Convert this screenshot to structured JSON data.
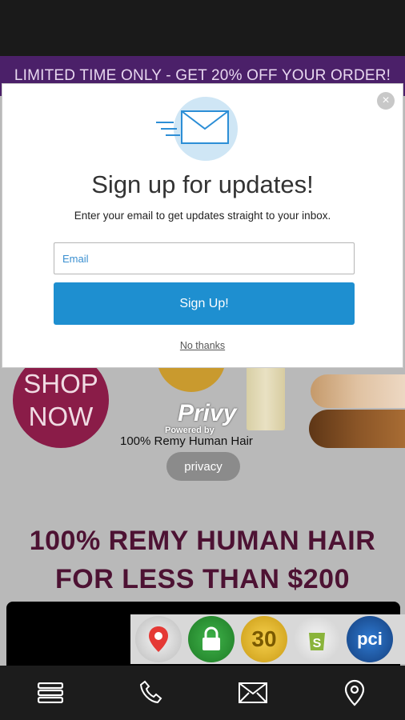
{
  "promo_banner": {
    "text": "LIMITED TIME ONLY - GET 20% OFF YOUR ORDER!"
  },
  "modal": {
    "title": "Sign up for updates!",
    "subtitle": "Enter your email to get updates straight to your inbox.",
    "email_placeholder": "Email",
    "signup_label": "Sign Up!",
    "no_thanks_label": "No thanks",
    "close_icon": "close-icon",
    "emblem_icon": "envelope-icon"
  },
  "background": {
    "shop_now_line1": "SHOP",
    "shop_now_line2": "NOW",
    "product_caption": "100% Remy Human Hair",
    "privy_logo": "Privy",
    "privy_powered": "Powered by",
    "privacy_label": "privacy",
    "headline_line1": "100% REMY HUMAN HAIR",
    "headline_line2": "FOR LESS THAN $200",
    "trust_badges": [
      {
        "icon": "map-pin-badge-icon",
        "label": ""
      },
      {
        "icon": "lock-badge-icon",
        "label": ""
      },
      {
        "icon": "thirty-day-badge-icon",
        "label": "30"
      },
      {
        "icon": "shopify-badge-icon",
        "label": ""
      },
      {
        "icon": "pci-badge-icon",
        "label": "pci"
      }
    ]
  },
  "bottom_nav": {
    "items": [
      "menu-icon",
      "phone-icon",
      "mail-icon",
      "location-pin-icon"
    ]
  },
  "colors": {
    "banner": "#4b2069",
    "accent": "#1e8fd0",
    "headline": "#4d1233",
    "shop_now": "#8a1c48"
  }
}
